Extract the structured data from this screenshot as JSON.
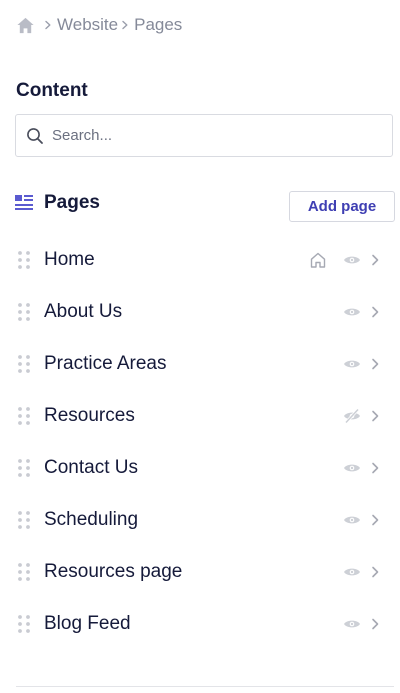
{
  "breadcrumb": {
    "home_icon": "home-icon",
    "items": [
      "Website",
      "Pages"
    ]
  },
  "content": {
    "title": "Content",
    "search_placeholder": "Search..."
  },
  "pages": {
    "title": "Pages",
    "add_label": "Add page",
    "accent_color": "#4b4bc4",
    "items": [
      {
        "label": "Home",
        "is_home": true,
        "visible": true
      },
      {
        "label": "About Us",
        "is_home": false,
        "visible": true
      },
      {
        "label": "Practice Areas",
        "is_home": false,
        "visible": true
      },
      {
        "label": "Resources",
        "is_home": false,
        "visible": false
      },
      {
        "label": "Contact Us",
        "is_home": false,
        "visible": true
      },
      {
        "label": "Scheduling",
        "is_home": false,
        "visible": true
      },
      {
        "label": "Resources page",
        "is_home": false,
        "visible": true
      },
      {
        "label": "Blog Feed",
        "is_home": false,
        "visible": true
      }
    ]
  }
}
